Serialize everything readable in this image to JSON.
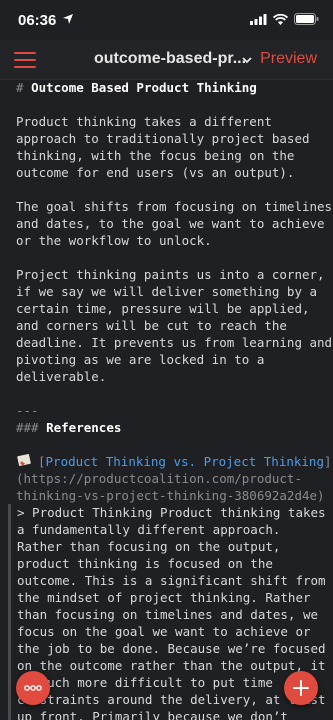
{
  "status": {
    "time": "06:36",
    "icons": [
      "location-arrow-icon",
      "signal-icon",
      "wifi-icon",
      "battery-icon"
    ]
  },
  "navbar": {
    "menu_icon": "hamburger-icon",
    "title": "outcome-based-pr...",
    "chevron_icon": "chevron-down-icon",
    "preview_label": "Preview"
  },
  "editor": {
    "h1_mark": "# ",
    "h1_text": "Outcome Based Product Thinking",
    "p1": [
      "Product thinking takes a different",
      "approach to traditionally project based",
      "thinking, with the focus being on the",
      "outcome for end users (vs an output)."
    ],
    "p2": [
      "The goal shifts from focusing on timelines",
      "and dates, to the goal we want to achieve",
      "or the workflow to unlock."
    ],
    "p3": [
      "Project thinking paints us into a corner,",
      "if we say we will deliver something by a",
      "certain time, pressure will be applied,",
      "and corners will be cut to reach the",
      "deadline. It prevents us from learning and",
      "pivoting as we are locked in to a",
      "deliverable."
    ],
    "hr": "---",
    "h3_mark": "### ",
    "h3_text": "References",
    "ref_icon": "bookmark-ribbon-icon",
    "ref_bracket_open": "[",
    "ref_link_text": "Product Thinking vs. Project Thinking",
    "ref_bracket_close": "]",
    "ref_url_lines": [
      "(https://productcoalition.com/product-",
      "thinking-vs-project-thinking-380692a2d4e)"
    ],
    "quote_lines": [
      "> Product Thinking Product thinking takes",
      "a fundamentally different approach.",
      "Rather than focusing on the output,",
      "product thinking is focused on the",
      "outcome. This is a significant shift from",
      "the mindset of project thinking. Rather",
      "than focusing on timelines and dates, we",
      "focus on the goal we want to achieve or",
      "the job to be done. Because we’re focused",
      "on the outcome rather than the output, it",
      "is much more difficult to put time",
      "constraints around the delivery, at least",
      "up front. Primarily because we don’t"
    ]
  },
  "fabs": {
    "more_icon": "more-dots-icon",
    "add_icon": "plus-icon"
  },
  "colors": {
    "accent": "#e04a3f",
    "link": "#4d9be6",
    "background": "#1f2023",
    "text": "#d7d8d9",
    "muted": "#8a8b8e"
  }
}
